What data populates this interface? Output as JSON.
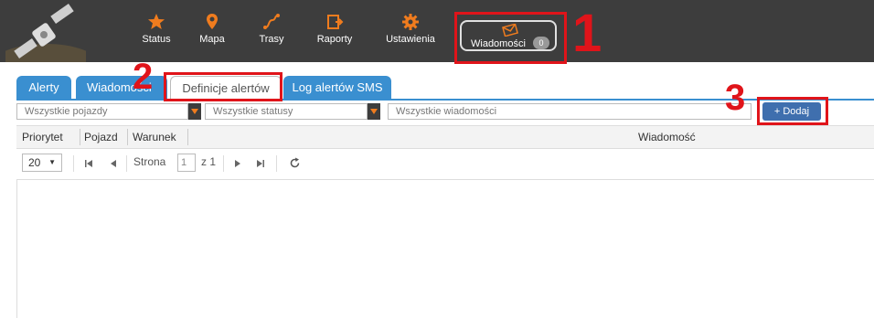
{
  "nav": {
    "items": [
      {
        "label": "Status",
        "icon": "star-icon"
      },
      {
        "label": "Mapa",
        "icon": "map-pin-icon"
      },
      {
        "label": "Trasy",
        "icon": "route-icon"
      },
      {
        "label": "Raporty",
        "icon": "report-icon"
      },
      {
        "label": "Ustawienia",
        "icon": "gear-icon"
      }
    ],
    "messages": {
      "label": "Wiadomości",
      "count": "0",
      "icon": "envelope-icon"
    }
  },
  "annotations": [
    "1",
    "2",
    "3"
  ],
  "tabs": [
    {
      "label": "Alerty"
    },
    {
      "label": "Wiadomości"
    },
    {
      "label": "Definicje alertów"
    },
    {
      "label": "Log alertów SMS"
    }
  ],
  "filters": {
    "vehicles": "Wszystkie pojazdy",
    "statuses": "Wszystkie statusy",
    "messages": "Wszystkie wiadomości"
  },
  "add_button": "+ Dodaj",
  "columns": [
    "Priorytet",
    "Pojazd",
    "Warunek",
    "Wiadomość"
  ],
  "pager": {
    "page_size": "20",
    "page_label": "Strona",
    "page_value": "1",
    "of_label": "z 1"
  },
  "colors": {
    "accent": "#3a8fd0",
    "nav_icon": "#f07c1e",
    "annotation": "#e0141a",
    "topbar": "#3d3d3d"
  }
}
